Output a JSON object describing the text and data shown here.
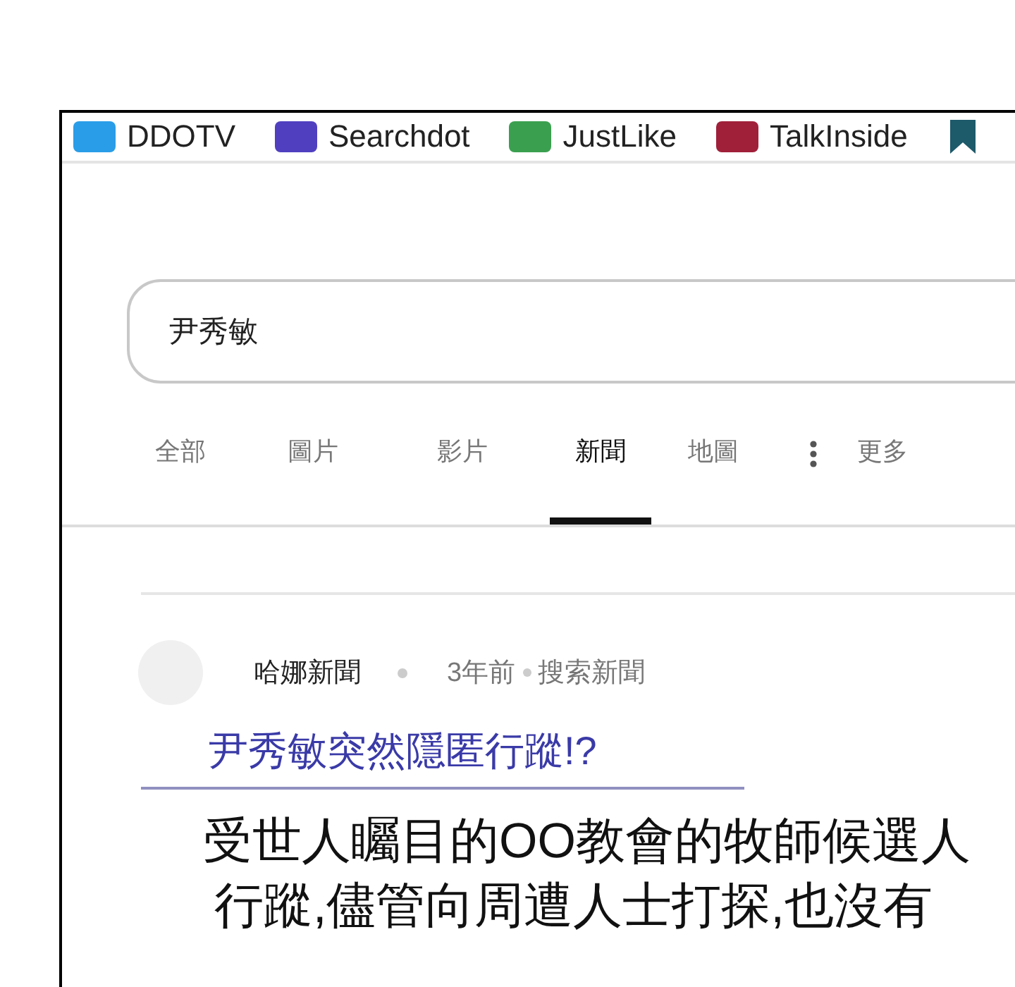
{
  "bookmarks": [
    {
      "label": "DDOTV",
      "color": "#2a9de8"
    },
    {
      "label": "Searchdot",
      "color": "#5040c0"
    },
    {
      "label": "JustLike",
      "color": "#3aa050"
    },
    {
      "label": "TalkInside",
      "color": "#a0203a"
    }
  ],
  "search": {
    "value": "尹秀敏"
  },
  "tabs": [
    {
      "label": "全部",
      "selected": false,
      "kind": "tab"
    },
    {
      "label": "圖片",
      "selected": false,
      "kind": "tab"
    },
    {
      "label": "影片",
      "selected": false,
      "kind": "tab"
    },
    {
      "label": "新聞",
      "selected": true,
      "kind": "tab"
    },
    {
      "label": "地圖",
      "selected": false,
      "kind": "tab"
    },
    {
      "label": "更多",
      "selected": false,
      "kind": "more"
    }
  ],
  "result": {
    "source": "哈娜新聞",
    "age": "3年前",
    "origin": "搜索新聞",
    "title": "尹秀敏突然隱匿行蹤!?",
    "snippet_lines": [
      "受世人矚目的OO教會的牧師候選人",
      "行蹤,儘管向周遭人士打探,也沒有"
    ]
  }
}
